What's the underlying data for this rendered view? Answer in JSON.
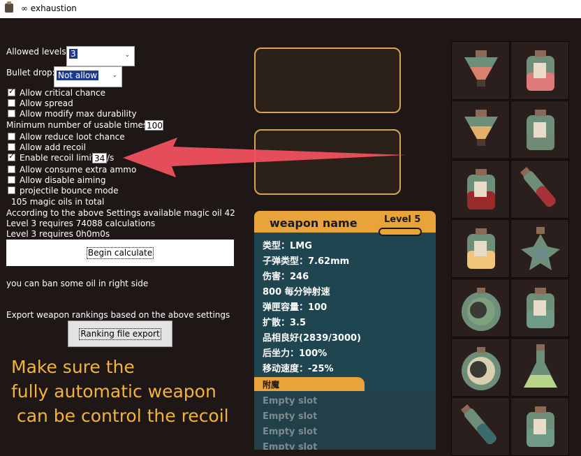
{
  "window": {
    "title": "∞ exhaustion"
  },
  "settings": {
    "allowed_levels_label": "Allowed levels:",
    "allowed_levels_value": "3",
    "bullet_drop_label": "Bullet drop:",
    "bullet_drop_value": "Not allow",
    "checkboxes": [
      {
        "label": "Allow critical chance",
        "checked": true
      },
      {
        "label": "Allow spread",
        "checked": false
      },
      {
        "label": "Allow modify max durability",
        "checked": false
      }
    ],
    "min_usable_label": "Minimum number of usable times:",
    "min_usable_value": "100",
    "checkboxes2": [
      {
        "label": "Allow reduce loot chance",
        "checked": false
      },
      {
        "label": "Allow add recoil",
        "checked": false
      },
      {
        "label": "Enable recoil limit",
        "checked": true
      }
    ],
    "recoil_limit_value": "34",
    "recoil_unit": "/s",
    "checkboxes3": [
      {
        "label": "Allow consume extra ammo",
        "checked": false
      },
      {
        "label": "Allow disable aiming",
        "checked": false
      },
      {
        "label": "projectile bounce mode",
        "checked": false
      }
    ],
    "total_oils": "105 magic oils in total",
    "available_oils": "According to the above Settings available magic oil 42",
    "calc_count": "Level 3 requires 74088 calculations",
    "calc_time": "Level 3 requires 0h0m0s",
    "begin_button": "Begin calculate",
    "ban_hint": "you can ban some oil in right side",
    "export_hint": "Export weapon rankings based on the above settings",
    "export_button": "Ranking file export"
  },
  "note": {
    "lines": [
      "Make sure the",
      "fully automatic weapon",
      " can be control the recoil"
    ],
    "color": "#f2b33d"
  },
  "weapon": {
    "name": "weapon name",
    "level": "Level 5",
    "stats": [
      "类型：LMG",
      "子弹类型：7.62mm",
      "伤害：246",
      "800 每分钟射速",
      "弹匣容量：100",
      "扩散：3.5",
      "品相良好(2839/3000)",
      "后坐力：100%",
      "移动速度：-25%"
    ],
    "enchant_label": "附魔",
    "slots": [
      "Empty slot",
      "Empty slot",
      "Empty slot",
      "Empty slot"
    ]
  },
  "oils": [
    {
      "shape": "triangle",
      "liquid": "#d9806f"
    },
    {
      "shape": "jar",
      "liquid": "#e07a78"
    },
    {
      "shape": "triangle",
      "liquid": "#e3b06a"
    },
    {
      "shape": "jar",
      "liquid": "#6f8a75"
    },
    {
      "shape": "jar",
      "liquid": "#9a2a2a"
    },
    {
      "shape": "vial",
      "liquid": "#a8323a"
    },
    {
      "shape": "jar",
      "liquid": "#f0c47a"
    },
    {
      "shape": "star",
      "liquid": "#6f8a8a"
    },
    {
      "shape": "round",
      "liquid": "#7fa07f"
    },
    {
      "shape": "jar",
      "liquid": "#6f9a85"
    },
    {
      "shape": "round",
      "liquid": "#d8d0b0"
    },
    {
      "shape": "flask",
      "liquid": "#b7d48a"
    },
    {
      "shape": "vial",
      "liquid": "#3c6a6a"
    },
    {
      "shape": "jar",
      "liquid": "#6f9a85"
    }
  ],
  "colors": {
    "accent": "#e8a33b",
    "card": "#1f4650",
    "arrow": "#f0505f"
  }
}
